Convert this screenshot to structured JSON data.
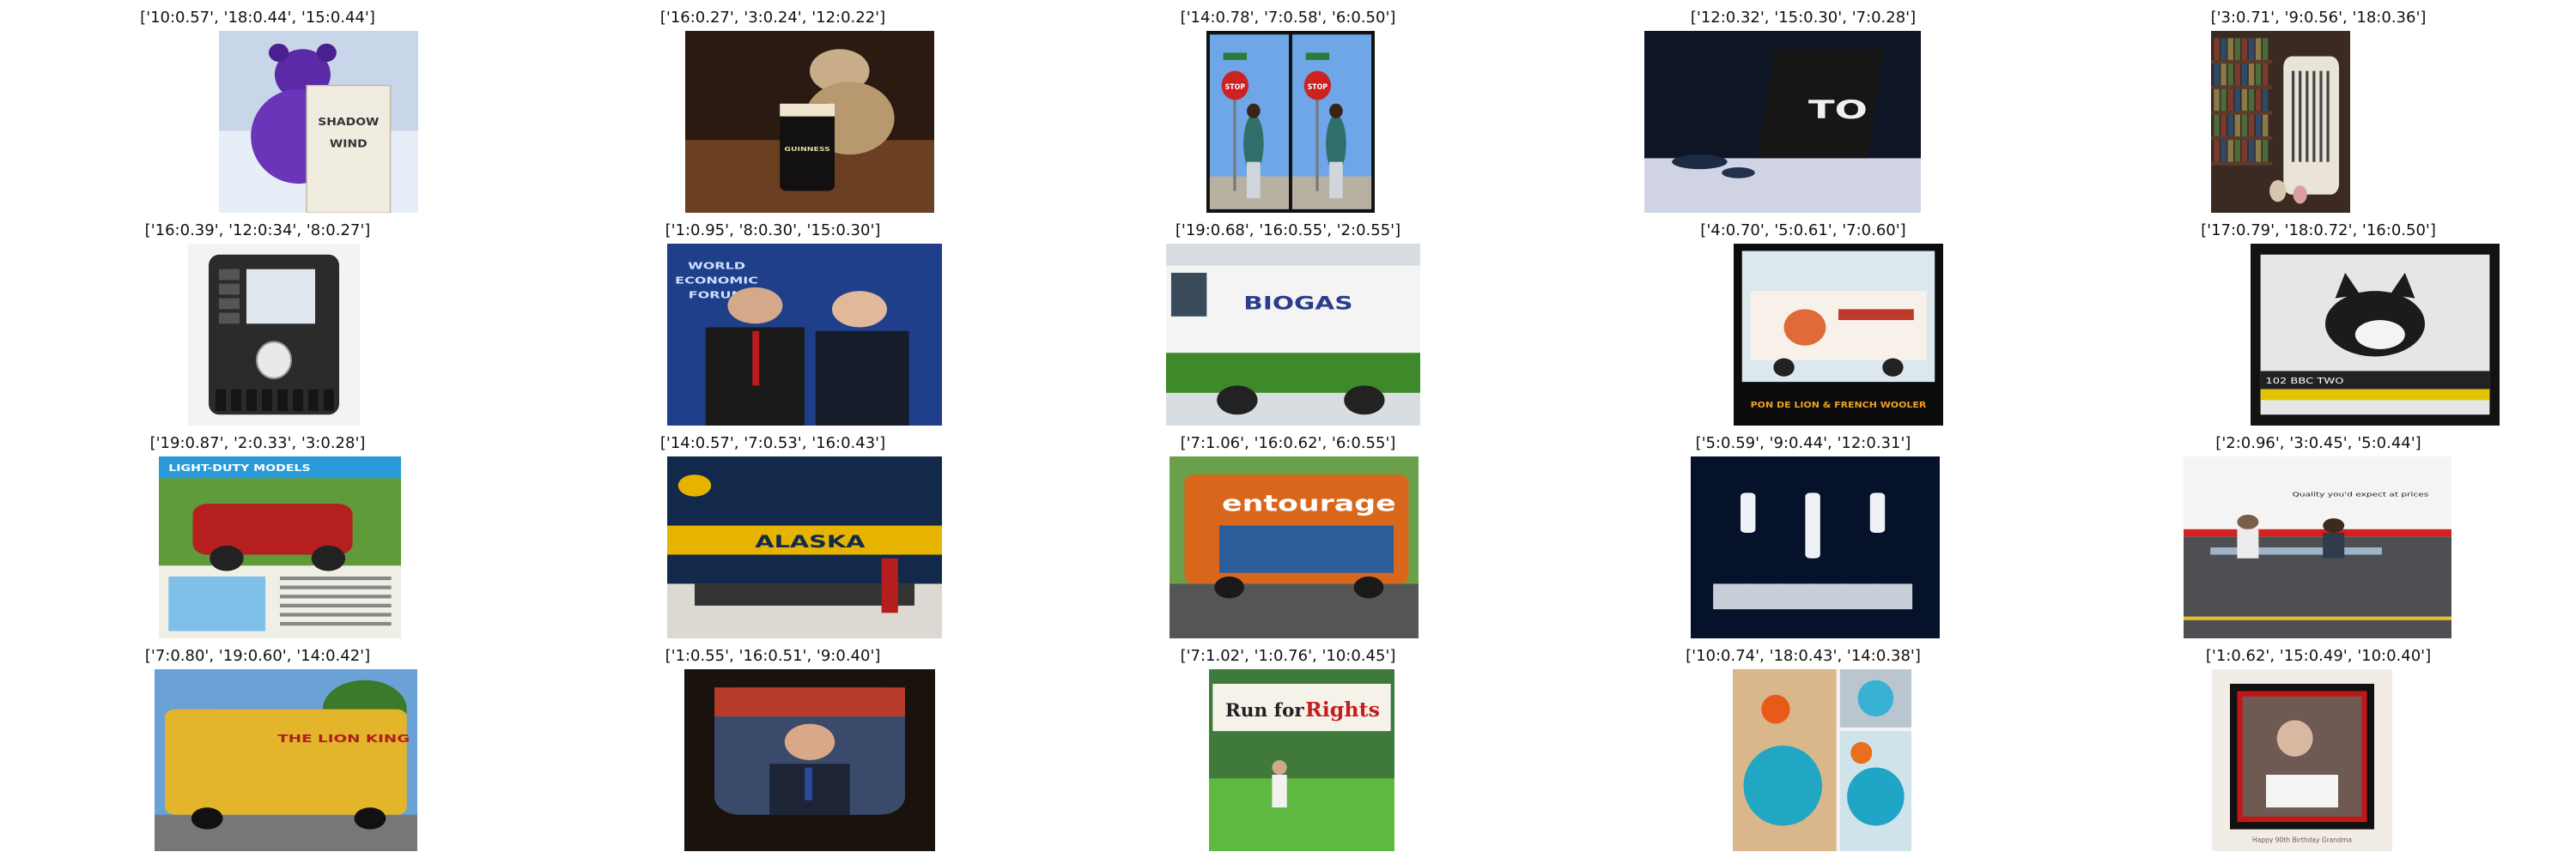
{
  "panels": [
    {
      "caption": "['10:0.57', '18:0.44', '15:0.44']",
      "scene": "purple-teddy-reading",
      "lines": [
        "SHADOW",
        "WIND"
      ]
    },
    {
      "caption": "['16:0.27', '3:0.24', '12:0.22']",
      "scene": "teddy-with-pint",
      "lines": [
        "GUINNESS"
      ]
    },
    {
      "caption": "['14:0.78', '7:0.58', '6:0.50']",
      "scene": "woman-stop-sign-diptych",
      "lines": [
        "STOP",
        "STOP"
      ]
    },
    {
      "caption": "['12:0.32', '15:0.30', '7:0.28']",
      "scene": "laptop-desk",
      "lines": [
        "TO"
      ]
    },
    {
      "caption": "['3:0.71', '9:0.56', '18:0.36']",
      "scene": "bookshelf-vase",
      "lines": []
    },
    {
      "caption": "['16:0.39', '12:0:34', '8:0.27']",
      "scene": "car-dashboard-radio",
      "lines": []
    },
    {
      "caption": "['1:0.95', '8:0.30', '15:0.30']",
      "scene": "two-men-forum",
      "lines": [
        "WORLD",
        "ECONOMIC",
        "FORUM"
      ]
    },
    {
      "caption": "['19:0.68', '16:0.55', '2:0.55']",
      "scene": "biogas-bus",
      "lines": [
        "BIOGAS"
      ]
    },
    {
      "caption": "['4:0.70', '5:0.61', '7:0.60']",
      "scene": "decorated-bus",
      "lines": [
        "PON DE LION & FRENCH WOOLER"
      ]
    },
    {
      "caption": "['17:0.79', '18:0.72', '16:0.50']",
      "scene": "tv-cat-cartoon",
      "lines": [
        "102 BBC TWO"
      ]
    },
    {
      "caption": "['19:0.87', '2:0.33', '3:0.28']",
      "scene": "vintage-truck-ad",
      "lines": [
        "LIGHT-DUTY MODELS"
      ]
    },
    {
      "caption": "['14:0.57', '7:0.53', '16:0.43']",
      "scene": "alaska-train",
      "lines": [
        "ALASKA"
      ]
    },
    {
      "caption": "['7:1.06', '16:0.62', '6:0.55']",
      "scene": "entourage-bus",
      "lines": [
        "entourage"
      ]
    },
    {
      "caption": "['5:0.59', '9:0.44', '12:0.31']",
      "scene": "wii-controllers",
      "lines": []
    },
    {
      "caption": "['2:0.96', '3:0.45', '5:0.44']",
      "scene": "bench-women",
      "lines": [
        "Quality you'd expect at prices"
      ]
    },
    {
      "caption": "['7:0.80', '19:0.60', '14:0.42']",
      "scene": "lion-king-bus",
      "lines": [
        "THE LION KING"
      ]
    },
    {
      "caption": "['1:0.55', '16:0.51', '9:0.40']",
      "scene": "tv-newsman",
      "lines": []
    },
    {
      "caption": "['7:1.02', '1:0.76', '10:0.45']",
      "scene": "run-for-rights",
      "lines": [
        "Run for",
        "Rights"
      ]
    },
    {
      "caption": "['10:0.74', '18:0.43', '14:0.38']",
      "scene": "blue-glass-flowers",
      "lines": []
    },
    {
      "caption": "['1:0.62', '15:0.49', '10:0.40']",
      "scene": "birthday-grandma",
      "lines": [
        "Happy 90th Birthday Grandma"
      ]
    }
  ]
}
